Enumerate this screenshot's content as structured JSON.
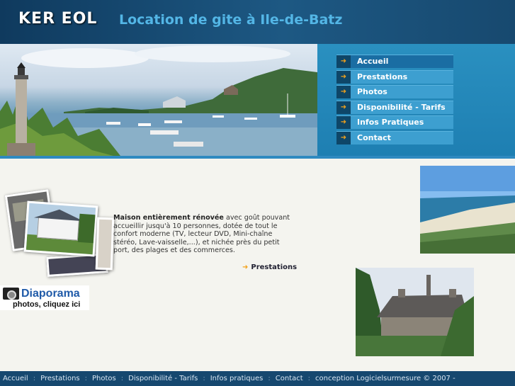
{
  "header": {
    "logo": "KER EOL",
    "title": "Location de gite à Ile-de-Batz"
  },
  "nav": {
    "items": [
      {
        "label": "Accueil",
        "active": true
      },
      {
        "label": "Prestations",
        "active": false
      },
      {
        "label": "Photos",
        "active": false
      },
      {
        "label": "Disponibilité - Tarifs",
        "active": false
      },
      {
        "label": "Infos Pratiques",
        "active": false
      },
      {
        "label": "Contact",
        "active": false
      }
    ],
    "arrow_icon": "arrow-right-icon",
    "accent_color": "#f2a21c"
  },
  "intro": {
    "bold_text": "Maison entièrement rénovée",
    "text": " avec goût pouvant accueillir jusqu'à 10 personnes, dotée de tout le confort moderne (TV, lecteur DVD, Mini-chaîne stéréo, Lave-vaisselle,...), et nichée près du petit port, des plages et des commerces."
  },
  "more_link": {
    "label": "Prestations"
  },
  "diaporama": {
    "title": "Diaporama",
    "subtitle": "photos, cliquez ici",
    "icon": "camera-icon"
  },
  "footer": {
    "links": [
      "Accueil",
      "Prestations",
      "Photos",
      "Disponibilité - Tarifs",
      "Infos pratiques",
      "Contact"
    ],
    "separator": ":",
    "credit": "conception Logicielsurmesure © 2007 -"
  }
}
